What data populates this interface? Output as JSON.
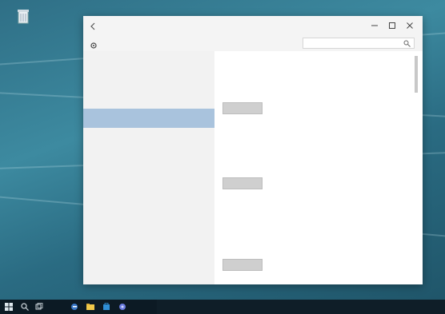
{
  "desktop": {
    "icons": [
      {
        "name": "recycle-bin",
        "label": ""
      }
    ]
  },
  "window": {
    "title": "",
    "page_title": "",
    "search": {
      "placeholder": "",
      "value": ""
    },
    "sidebar": {
      "items": [
        {
          "label": "",
          "selected": false
        },
        {
          "label": "",
          "selected": false
        },
        {
          "label": "",
          "selected": false
        },
        {
          "label": "",
          "selected": true
        },
        {
          "label": "",
          "selected": false
        },
        {
          "label": "",
          "selected": false
        }
      ]
    },
    "sections": [
      {
        "title": "",
        "description": "",
        "button": ""
      },
      {
        "title": "",
        "description": "",
        "button": ""
      },
      {
        "title": "",
        "description": "",
        "button": ""
      }
    ]
  },
  "taskbar": {
    "icons": [
      "windows-start-icon",
      "search-icon",
      "task-view-icon",
      "edge-icon",
      "file-explorer-icon",
      "store-icon",
      "app-icon"
    ]
  },
  "colors": {
    "selected_item": "#a9c3dd",
    "button_bg": "#cfcfcf",
    "taskbar": "#0c1a24",
    "desktop": "#2f6f86"
  }
}
